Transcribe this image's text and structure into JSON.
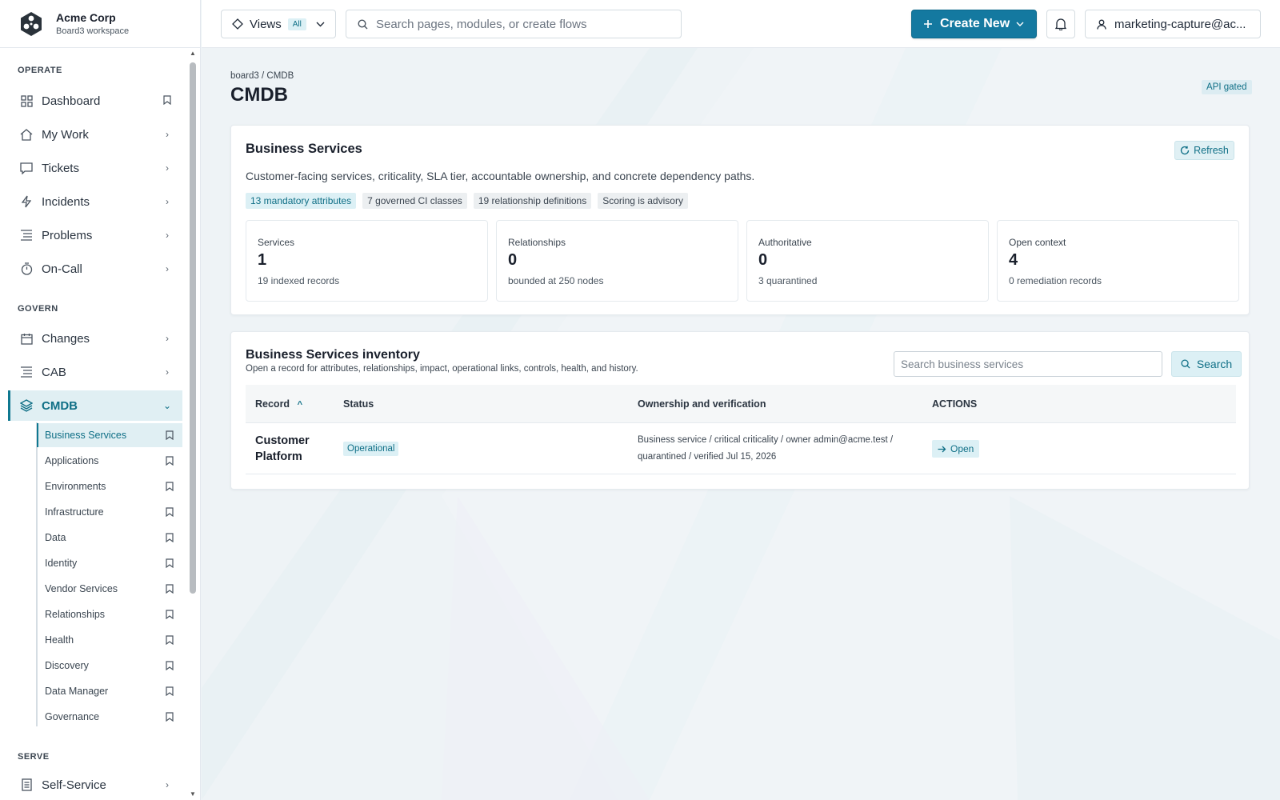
{
  "brand": {
    "name": "Acme Corp",
    "workspace": "Board3 workspace"
  },
  "sidebar": {
    "sections": {
      "operate": "OPERATE",
      "govern": "GOVERN",
      "serve": "SERVE"
    },
    "items": {
      "dashboard": "Dashboard",
      "my_work": "My Work",
      "tickets": "Tickets",
      "incidents": "Incidents",
      "problems": "Problems",
      "on_call": "On-Call",
      "changes": "Changes",
      "cab": "CAB",
      "cmdb": "CMDB",
      "self_service": "Self-Service"
    },
    "cmdb_sub": [
      "Business Services",
      "Applications",
      "Environments",
      "Infrastructure",
      "Data",
      "Identity",
      "Vendor Services",
      "Relationships",
      "Health",
      "Discovery",
      "Data Manager",
      "Governance"
    ],
    "active_sub": "Business Services"
  },
  "topbar": {
    "views_label": "Views",
    "views_badge": "All",
    "search_placeholder": "Search pages, modules, or create flows",
    "create_label": "Create New",
    "user_label": "marketing-capture@ac..."
  },
  "page": {
    "breadcrumb": "board3 / CMDB",
    "title": "CMDB",
    "api_badge": "API gated"
  },
  "summary": {
    "title": "Business Services",
    "refresh_label": "Refresh",
    "description": "Customer-facing services, criticality, SLA tier, accountable ownership, and concrete dependency paths.",
    "chips": [
      "13 mandatory attributes",
      "7 governed CI classes",
      "19 relationship definitions",
      "Scoring is advisory"
    ],
    "stats": [
      {
        "label": "Services",
        "value": "1",
        "sub": "19 indexed records"
      },
      {
        "label": "Relationships",
        "value": "0",
        "sub": "bounded at 250 nodes"
      },
      {
        "label": "Authoritative",
        "value": "0",
        "sub": "3 quarantined"
      },
      {
        "label": "Open context",
        "value": "4",
        "sub": "0 remediation records"
      }
    ]
  },
  "inventory": {
    "title": "Business Services inventory",
    "description": "Open a record for attributes, relationships, impact, operational links, controls, health, and history.",
    "search_placeholder": "Search business services",
    "search_label": "Search",
    "columns": {
      "record": "Record",
      "sort_indicator": "^",
      "status": "Status",
      "ownership": "Ownership and verification",
      "actions": "ACTIONS"
    },
    "rows": [
      {
        "record": "Customer Platform",
        "status": "Operational",
        "ownership": "Business service / critical criticality / owner admin@acme.test / quarantined / verified Jul 15, 2026",
        "action": "Open"
      }
    ]
  },
  "colors": {
    "accent": "#1479a0",
    "accent_text": "#0f6f86",
    "accent_soft": "#dcf0f5"
  }
}
